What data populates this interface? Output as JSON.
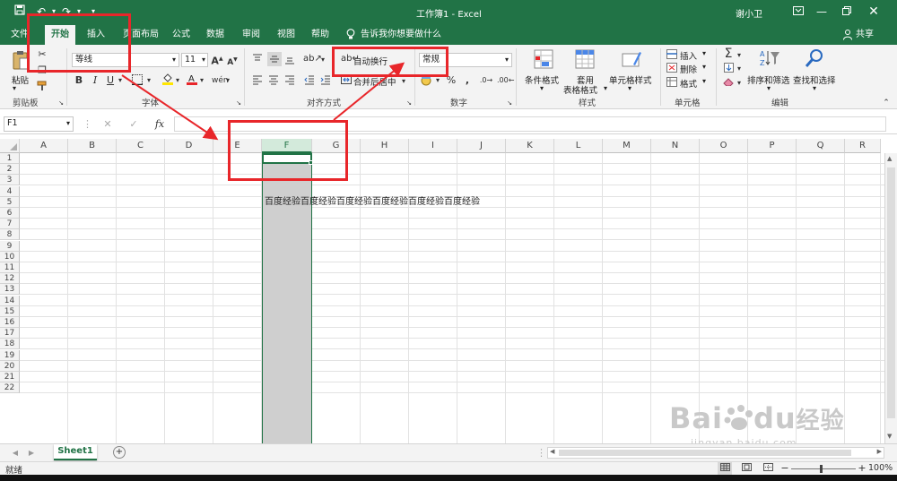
{
  "window": {
    "title": "工作簿1  -  Excel",
    "user": "谢小卫"
  },
  "tabs": [
    {
      "label": "文件"
    },
    {
      "label": "开始"
    },
    {
      "label": "插入"
    },
    {
      "label": "页面布局"
    },
    {
      "label": "公式"
    },
    {
      "label": "数据"
    },
    {
      "label": "审阅"
    },
    {
      "label": "视图"
    },
    {
      "label": "帮助"
    }
  ],
  "tellme": "告诉我你想要做什么",
  "share": "共享",
  "ribbon": {
    "paste": "粘贴",
    "font_name": "等线",
    "font_size": "11",
    "wrap_text": "自动换行",
    "merge_center": "合并后居中",
    "number_format": "常规",
    "conditional_format": "条件格式",
    "format_table_1": "套用",
    "format_table_2": "表格格式",
    "cell_styles": "单元格样式",
    "insert": "插入",
    "delete": "删除",
    "format": "格式",
    "sort_filter": "排序和筛选",
    "find_select": "查找和选择",
    "groups": {
      "clipboard": "剪贴板",
      "font": "字体",
      "alignment": "对齐方式",
      "number": "数字",
      "styles": "样式",
      "cells": "单元格",
      "editing": "编辑"
    }
  },
  "formula_bar": {
    "name_box": "F1",
    "fx": "fx",
    "content": ""
  },
  "columns": [
    "A",
    "B",
    "C",
    "D",
    "E",
    "F",
    "G",
    "H",
    "I",
    "J",
    "K",
    "L",
    "M",
    "N",
    "O",
    "P",
    "Q",
    "R"
  ],
  "rows": [
    "1",
    "2",
    "3",
    "4",
    "5",
    "6",
    "7",
    "8",
    "9",
    "10",
    "11",
    "12",
    "13",
    "14",
    "15",
    "16",
    "17",
    "18",
    "19",
    "20",
    "21",
    "22"
  ],
  "cell_F4": "百度经验百度经验百度经验百度经验百度经验百度经验",
  "sheet_tab": "Sheet1",
  "status": {
    "ready": "就绪",
    "zoom": "100%"
  },
  "watermark": {
    "brand": "Bai",
    "suffix": "du",
    "cn": "经验",
    "url": "jingyan.baidu.com"
  },
  "colors": {
    "excel_green": "#217346",
    "annotation_red": "#e8262a"
  }
}
